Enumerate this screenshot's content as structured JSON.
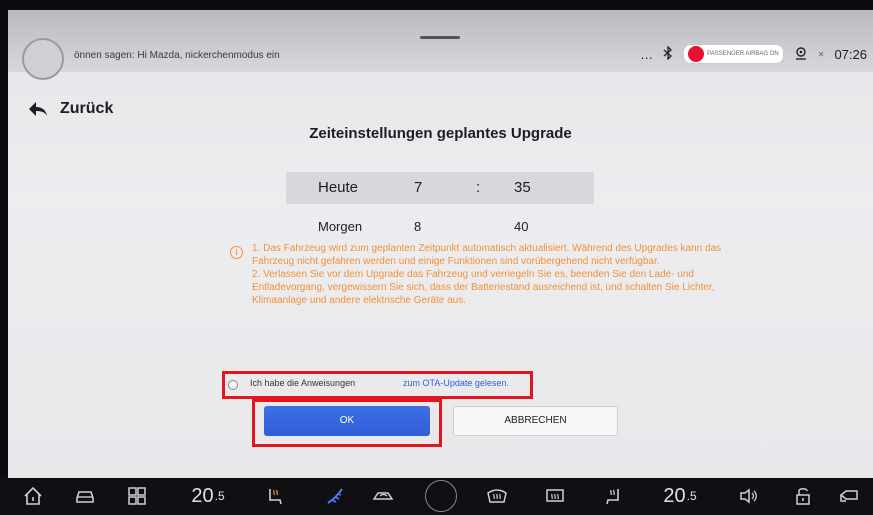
{
  "statusbar": {
    "voice_hint": "önnen sagen: Hi Mazda, nickerchenmodus ein",
    "more": "…",
    "airbag_label": "PASSENGER AIRBAG ON",
    "time": "07:26"
  },
  "nav": {
    "back_label": "Zurück"
  },
  "dialog": {
    "title": "Zeiteinstellungen geplantes Upgrade",
    "picker": {
      "selected": {
        "day": "Heute",
        "hour": "7",
        "separator": ":",
        "minute": "35"
      },
      "next": {
        "day": "Morgen",
        "hour": "8",
        "minute": "40"
      }
    },
    "warning": {
      "line1": "1. Das Fahrzeug wird zum geplanten Zeitpunkt automatisch aktualisiert. Während des Upgrades kann das Fahrzeug nicht gefahren werden und einige Funktionen sind vorübergehend nicht verfügbar.",
      "line2": "2. Verlassen Sie vor dem Upgrade das Fahrzeug und verriegeln Sie es, beenden Sie den Lade- und Entladevorgang, vergewissern Sie sich, dass der Batteriestand ausreichend ist, und schalten Sie Lichter, Klimaanlage und andere elektrische Geräte aus."
    },
    "ack_text": "Ich habe die Anweisungen",
    "ack_link": "zum OTA-Update gelesen.",
    "ok_label": "OK",
    "cancel_label": "ABBRECHEN"
  },
  "dock": {
    "temp_left": "20",
    "temp_left_decimal": ".5",
    "temp_right": "20",
    "temp_right_decimal": ".5"
  },
  "colors": {
    "accent_blue": "#2f5ed8",
    "warning_orange": "#f0913a",
    "highlight_red": "#e1161e"
  }
}
